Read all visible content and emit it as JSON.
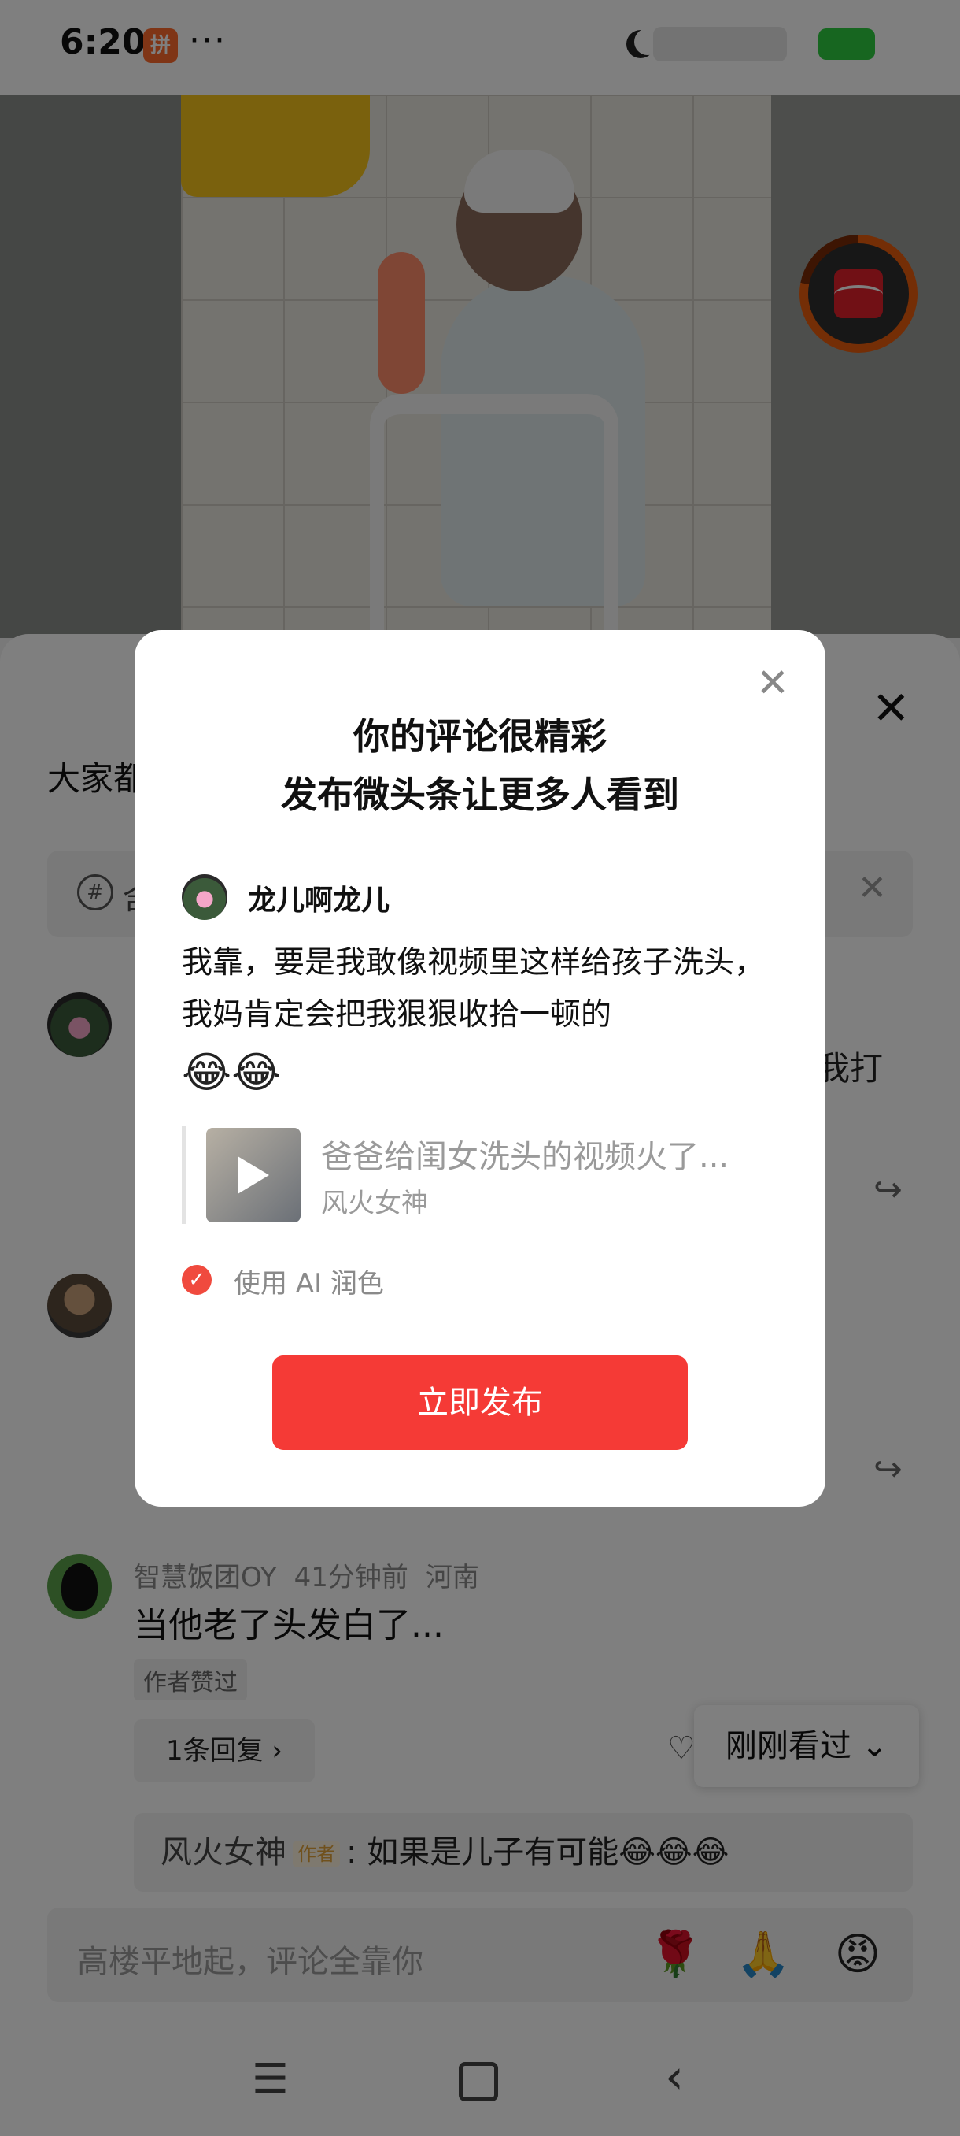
{
  "status": {
    "time": "6:20",
    "more": "···"
  },
  "sheet": {
    "title": "大家都",
    "topic_hash": "#",
    "topic_text": "含",
    "close": "✕",
    "topic_close": "✕"
  },
  "comments": [
    {
      "tail_text": "我打"
    },
    {},
    {
      "user": "智慧饭团OY",
      "time": "41分钟前",
      "location": "河南",
      "text": "当他老了头发白了...",
      "badge": "作者赞过",
      "replies": "1条回复 ›"
    }
  ],
  "author_reply": {
    "name": "风火女神",
    "tag": "作者",
    "text": ": 如果是儿子有可能😂😂😂"
  },
  "recent_button": "刚刚看过 ⌄",
  "comment_input": {
    "placeholder": "高楼平地起，评论全靠你"
  },
  "emoji_bar": [
    "🌹",
    "🙏",
    "😡"
  ],
  "dialog": {
    "title_line1": "你的评论很精彩",
    "title_line2": "发布微头条让更多人看到",
    "username": "龙儿啊龙儿",
    "text": "我靠，要是我敢像视频里这样给孩子洗头，我妈肯定会把我狠狠收拾一顿的",
    "emojis": "😂😂",
    "quote_title": "爸爸给闺女洗头的视频火了...",
    "quote_author": "风火女神",
    "ai_label": "使用 AI 润色",
    "publish_button": "立即发布",
    "close": "✕"
  },
  "colors": {
    "accent": "#f53a36",
    "check": "#f04a3e"
  }
}
